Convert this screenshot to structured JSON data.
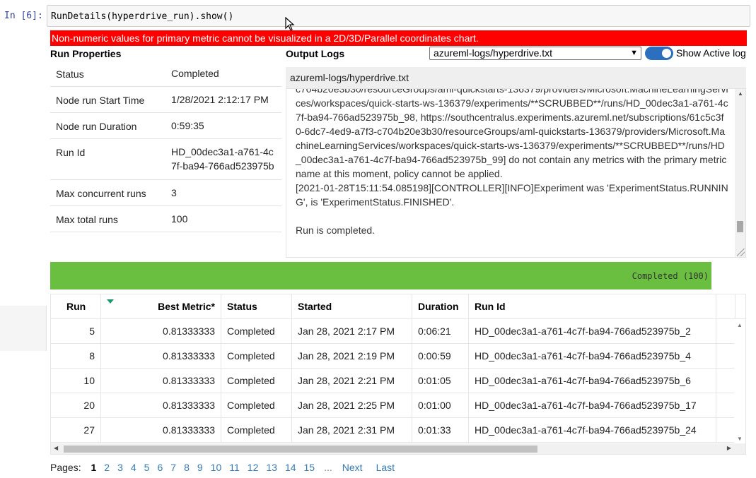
{
  "cell": {
    "prompt": "In [6]:",
    "code": "RunDetails(hyperdrive_run).show()"
  },
  "error_message": "Non-numeric values for primary metric cannot be visualized in a 2D/3D/Parallel coordinates chart.",
  "run_properties": {
    "title": "Run Properties",
    "rows": [
      {
        "key": "Status",
        "value": "Completed"
      },
      {
        "key": "Node run Start Time",
        "value": "1/28/2021 2:12:17 PM"
      },
      {
        "key": "Node run Duration",
        "value": "0:59:35"
      },
      {
        "key": "Run Id",
        "value": "HD_00dec3a1-a761-4c7f-ba94-766ad523975b"
      },
      {
        "key": "Max concurrent runs",
        "value": "3"
      },
      {
        "key": "Max total runs",
        "value": "100"
      }
    ]
  },
  "output_logs": {
    "title": "Output Logs",
    "selected_log": "azureml-logs/hyperdrive.txt",
    "toggle_label": "Show Active log",
    "toggle_on": true,
    "header": "azureml-logs/hyperdrive.txt",
    "lines": [
      "c704b20e3b30/resourceGroups/aml-quickstarts-136379/providers/Microsoft.MachineLearningServices/workspaces/quick-starts-ws-136379/experiments/**SCRUBBED**/runs/HD_00dec3a1-a761-4c7f-ba94-766ad523975b_98, https://southcentralus.experiments.azureml.net/subscriptions/61c5c3f0-6dc7-4ed9-a7f3-c704b20e3b30/resourceGroups/aml-quickstarts-136379/providers/Microsoft.MachineLearningServices/workspaces/quick-starts-ws-136379/experiments/**SCRUBBED**/runs/HD_00dec3a1-a761-4c7f-ba94-766ad523975b_99] do not contain any metrics with the primary metric name at this moment, policy cannot be applied.",
      "[2021-01-28T15:11:54.085198][CONTROLLER][INFO]Experiment was 'ExperimentStatus.RUNNING', is 'ExperimentStatus.FINISHED'.",
      "",
      "Run is completed."
    ]
  },
  "progress": {
    "label": "Completed (100)",
    "fraction": 0.95,
    "color": "#6abf40"
  },
  "runs_table": {
    "columns": [
      "Run",
      "Best Metric*",
      "Status",
      "Started",
      "Duration",
      "Run Id"
    ],
    "rows": [
      [
        "5",
        "0.81333333",
        "Completed",
        "Jan 28, 2021 2:17 PM",
        "0:06:21",
        "HD_00dec3a1-a761-4c7f-ba94-766ad523975b_2"
      ],
      [
        "8",
        "0.81333333",
        "Completed",
        "Jan 28, 2021 2:19 PM",
        "0:00:59",
        "HD_00dec3a1-a761-4c7f-ba94-766ad523975b_4"
      ],
      [
        "10",
        "0.81333333",
        "Completed",
        "Jan 28, 2021 2:21 PM",
        "0:01:05",
        "HD_00dec3a1-a761-4c7f-ba94-766ad523975b_6"
      ],
      [
        "20",
        "0.81333333",
        "Completed",
        "Jan 28, 2021 2:25 PM",
        "0:01:00",
        "HD_00dec3a1-a761-4c7f-ba94-766ad523975b_17"
      ],
      [
        "27",
        "0.81333333",
        "Completed",
        "Jan 28, 2021 2:31 PM",
        "0:01:33",
        "HD_00dec3a1-a761-4c7f-ba94-766ad523975b_24"
      ]
    ]
  },
  "pager": {
    "label": "Pages:",
    "current": "1",
    "pages": [
      "1",
      "2",
      "3",
      "4",
      "5",
      "6",
      "7",
      "8",
      "9",
      "10",
      "11",
      "12",
      "13",
      "14",
      "15"
    ],
    "ellipsis": "...",
    "next": "Next",
    "last": "Last"
  },
  "colors": {
    "error": "#ff0000",
    "toggle": "#2c6fbf",
    "link": "#337ab7",
    "sort_indicator": "#1a9a6c"
  },
  "icons": {
    "cursor": "mouse-pointer-icon",
    "sort": "sort-descending-icon",
    "dropdown": "chevron-down-icon"
  }
}
